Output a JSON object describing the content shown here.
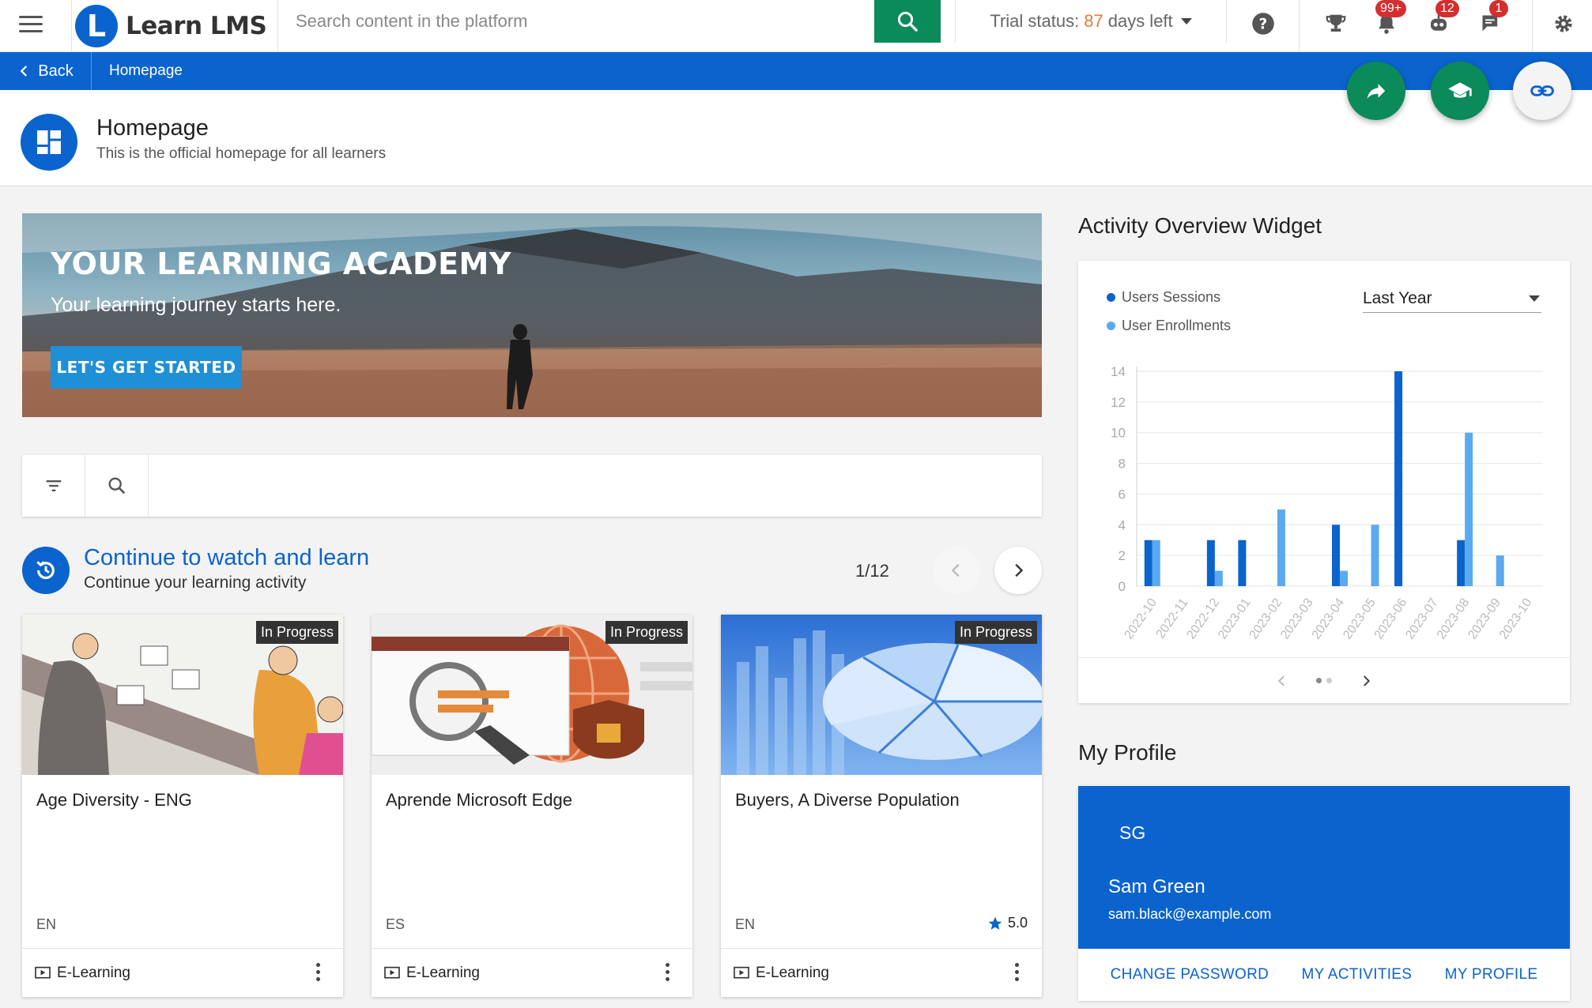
{
  "topbar": {
    "brand_initial": "L",
    "brand_name": "Learn LMS",
    "search_placeholder": "Search content in the platform",
    "trial_label": "Trial status:",
    "trial_days": "87",
    "trial_suffix": "days left",
    "badges": {
      "notifications": "99+",
      "robot": "12",
      "messages": "1"
    }
  },
  "navbar": {
    "back_label": "Back",
    "breadcrumb": "Homepage"
  },
  "header": {
    "title": "Homepage",
    "subtitle": "This is the official homepage for all learners"
  },
  "hero": {
    "title": "YOUR LEARNING ACADEMY",
    "subtitle": "Your learning journey starts here.",
    "button": "LET'S GET STARTED"
  },
  "continue": {
    "title": "Continue to watch and learn",
    "subtitle": "Continue your learning activity",
    "pager": "1/12"
  },
  "cards": [
    {
      "title": "Age Diversity - ENG",
      "status": "In Progress",
      "lang": "EN",
      "type": "E-Learning",
      "rating": ""
    },
    {
      "title": "Aprende Microsoft Edge",
      "status": "In Progress",
      "lang": "ES",
      "type": "E-Learning",
      "rating": ""
    },
    {
      "title": "Buyers, A Diverse Population",
      "status": "In Progress",
      "lang": "EN",
      "type": "E-Learning",
      "rating": "5.0"
    }
  ],
  "widget": {
    "title": "Activity Overview Widget",
    "legend": [
      "Users Sessions",
      "User Enrollments"
    ],
    "period": "Last Year"
  },
  "colors": {
    "primary": "#0b63ce",
    "green": "#0b8a5a",
    "sessions": "#0b63ce",
    "enrollments": "#5aaaf0",
    "trial_days": "#e07a3a"
  },
  "chart_data": {
    "type": "bar",
    "categories": [
      "2022-10",
      "2022-11",
      "2022-12",
      "2023-01",
      "2023-02",
      "2023-03",
      "2023-04",
      "2023-05",
      "2023-06",
      "2023-07",
      "2023-08",
      "2023-09",
      "2023-10"
    ],
    "series": [
      {
        "name": "Users Sessions",
        "values": [
          3,
          0,
          3,
          3,
          0,
          0,
          4,
          0,
          14,
          0,
          3,
          0,
          0
        ]
      },
      {
        "name": "User Enrollments",
        "values": [
          3,
          0,
          1,
          0,
          5,
          0,
          1,
          4,
          0,
          0,
          10,
          2,
          0
        ]
      }
    ],
    "yticks": [
      0,
      2,
      4,
      6,
      8,
      10,
      12,
      14
    ],
    "ylim": [
      0,
      14
    ],
    "grid": true,
    "legend": "top-left"
  },
  "profile": {
    "section_title": "My Profile",
    "initials": "SG",
    "name": "Sam Green",
    "email": "sam.black@example.com",
    "links": [
      "CHANGE PASSWORD",
      "MY ACTIVITIES",
      "MY PROFILE"
    ]
  }
}
